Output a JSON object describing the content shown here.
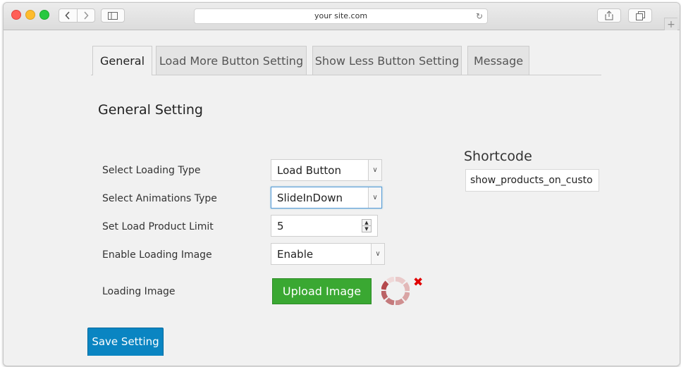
{
  "browser": {
    "address": "your site.com",
    "icons": {
      "back": "chevron-left-icon",
      "forward": "chevron-right-icon",
      "sidebar": "sidebar-icon",
      "reload": "reload-icon",
      "share": "share-icon",
      "tabs": "tabs-icon",
      "new_tab": "plus-icon"
    }
  },
  "tabs": [
    {
      "label": "General",
      "active": true
    },
    {
      "label": "Load More Button Setting",
      "active": false
    },
    {
      "label": "Show Less Button Setting",
      "active": false
    },
    {
      "label": "Message",
      "active": false
    }
  ],
  "page": {
    "title": "General Setting"
  },
  "form": {
    "loading_type": {
      "label": "Select Loading Type",
      "value": "Load Button"
    },
    "animation_type": {
      "label": "Select Animations Type",
      "value": "SlideInDown"
    },
    "product_limit": {
      "label": "Set Load Product Limit",
      "value": "5"
    },
    "loading_image_enable": {
      "label": "Enable Loading Image",
      "value": "Enable"
    },
    "loading_image": {
      "label": "Loading Image",
      "upload_label": "Upload Image",
      "remove_icon": "close-icon"
    }
  },
  "shortcode": {
    "title": "Shortcode",
    "value": "show_products_on_custo"
  },
  "actions": {
    "save_label": "Save Setting"
  },
  "colors": {
    "upload_button": "#3aa832",
    "save_button": "#0a85c2",
    "remove_icon": "#e00000",
    "loader": "#b5494d"
  }
}
